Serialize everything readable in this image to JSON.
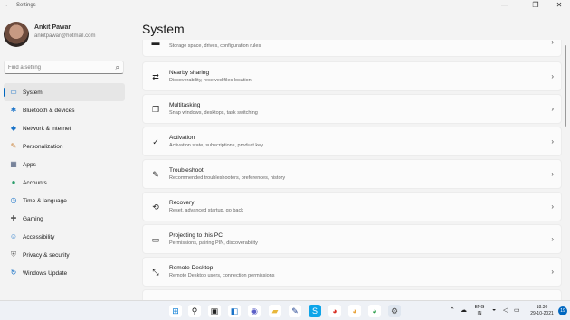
{
  "window": {
    "title": "Settings",
    "back_glyph": "←",
    "minimize_glyph": "—",
    "maximize_glyph": "❐",
    "close_glyph": "✕"
  },
  "profile": {
    "name": "Ankit Pawar",
    "email": "ankitpawar@hotmail.com"
  },
  "search": {
    "placeholder": "Find a setting",
    "icon": "search-icon"
  },
  "nav": {
    "items": [
      {
        "label": "System",
        "icon": "monitor-icon",
        "glyph": "▭",
        "color": "#1a73c8",
        "active": true
      },
      {
        "label": "Bluetooth & devices",
        "icon": "bluetooth-icon",
        "glyph": "✱",
        "color": "#1a73c8"
      },
      {
        "label": "Network & internet",
        "icon": "wifi-icon",
        "glyph": "◆",
        "color": "#1a73c8"
      },
      {
        "label": "Personalization",
        "icon": "brush-icon",
        "glyph": "✎",
        "color": "#c77a2a"
      },
      {
        "label": "Apps",
        "icon": "apps-icon",
        "glyph": "▦",
        "color": "#4a5a7a"
      },
      {
        "label": "Accounts",
        "icon": "accounts-icon",
        "glyph": "●",
        "color": "#2a9d6a"
      },
      {
        "label": "Time & language",
        "icon": "globe-clock-icon",
        "glyph": "◷",
        "color": "#1a73c8"
      },
      {
        "label": "Gaming",
        "icon": "gamepad-icon",
        "glyph": "✚",
        "color": "#555555"
      },
      {
        "label": "Accessibility",
        "icon": "accessibility-icon",
        "glyph": "☺",
        "color": "#1a73c8"
      },
      {
        "label": "Privacy & security",
        "icon": "shield-icon",
        "glyph": "⛨",
        "color": "#6b6b6b"
      },
      {
        "label": "Windows Update",
        "icon": "update-icon",
        "glyph": "↻",
        "color": "#1a73c8"
      }
    ]
  },
  "main": {
    "title": "System",
    "cards": [
      {
        "title": "",
        "subtitle": "Storage space, drives, configuration rules",
        "icon": "storage-icon",
        "glyph": "▬"
      },
      {
        "title": "Nearby sharing",
        "subtitle": "Discoverability, received files location",
        "icon": "nearby-sharing-icon",
        "glyph": "⇄"
      },
      {
        "title": "Multitasking",
        "subtitle": "Snap windows, desktops, task switching",
        "icon": "multitasking-icon",
        "glyph": "❐"
      },
      {
        "title": "Activation",
        "subtitle": "Activation state, subscriptions, product key",
        "icon": "activation-icon",
        "glyph": "✓"
      },
      {
        "title": "Troubleshoot",
        "subtitle": "Recommended troubleshooters, preferences, history",
        "icon": "wrench-icon",
        "glyph": "✎"
      },
      {
        "title": "Recovery",
        "subtitle": "Reset, advanced startup, go back",
        "icon": "recovery-icon",
        "glyph": "⟲"
      },
      {
        "title": "Projecting to this PC",
        "subtitle": "Permissions, pairing PIN, discoverability",
        "icon": "projecting-icon",
        "glyph": "▭"
      },
      {
        "title": "Remote Desktop",
        "subtitle": "Remote Desktop users, connection permissions",
        "icon": "remote-desktop-icon",
        "glyph": "⤡"
      },
      {
        "title": "",
        "subtitle": "",
        "icon": "clipboard-icon",
        "glyph": ""
      }
    ],
    "chevron": "›"
  },
  "taskbar": {
    "apps": [
      {
        "name": "start-icon",
        "glyph": "⊞",
        "bg": "#ffffff",
        "fg": "#0078d4"
      },
      {
        "name": "search-taskbar-icon",
        "glyph": "⚲",
        "bg": "#ffffff",
        "fg": "#222222"
      },
      {
        "name": "task-view-icon",
        "glyph": "▣",
        "bg": "#ffffff",
        "fg": "#222222"
      },
      {
        "name": "widgets-icon",
        "glyph": "◧",
        "bg": "#ffffff",
        "fg": "#1a73c8"
      },
      {
        "name": "chat-icon",
        "glyph": "◉",
        "bg": "#ffffff",
        "fg": "#5b5fc7"
      },
      {
        "name": "file-explorer-icon",
        "glyph": "▰",
        "bg": "#ffffff",
        "fg": "#e8b73b"
      },
      {
        "name": "edge-icon",
        "glyph": "◐",
        "bg": "#ffffff",
        "fg": "#1e8fd6"
      },
      {
        "name": "store-icon",
        "glyph": "▤",
        "bg": "#ffffff",
        "fg": "#333333"
      },
      {
        "name": "terminal-icon",
        "glyph": "✎",
        "bg": "#ffffff",
        "fg": "#1a3d8f"
      },
      {
        "name": "skype-icon",
        "glyph": "S",
        "bg": "#0ea5e9",
        "fg": "#ffffff"
      },
      {
        "name": "chrome-icon",
        "glyph": "◕",
        "bg": "#ffffff",
        "fg": "#d93025"
      },
      {
        "name": "chrome-canary-icon",
        "glyph": "◕",
        "bg": "#ffffff",
        "fg": "#e8a33b"
      },
      {
        "name": "chrome-dev-icon",
        "glyph": "◕",
        "bg": "#ffffff",
        "fg": "#2a9d4a"
      },
      {
        "name": "settings-app-icon",
        "glyph": "⚙",
        "bg": "#dfe6ef",
        "fg": "#555555"
      }
    ],
    "tray": {
      "chevron": "⌃",
      "cloud": "☁",
      "lang_top": "ENG",
      "lang_bottom": "IN",
      "wifi": "◒",
      "volume": "◁",
      "battery": "▭",
      "time": "18:30",
      "date": "29-10-2021",
      "notifications": "19"
    }
  }
}
